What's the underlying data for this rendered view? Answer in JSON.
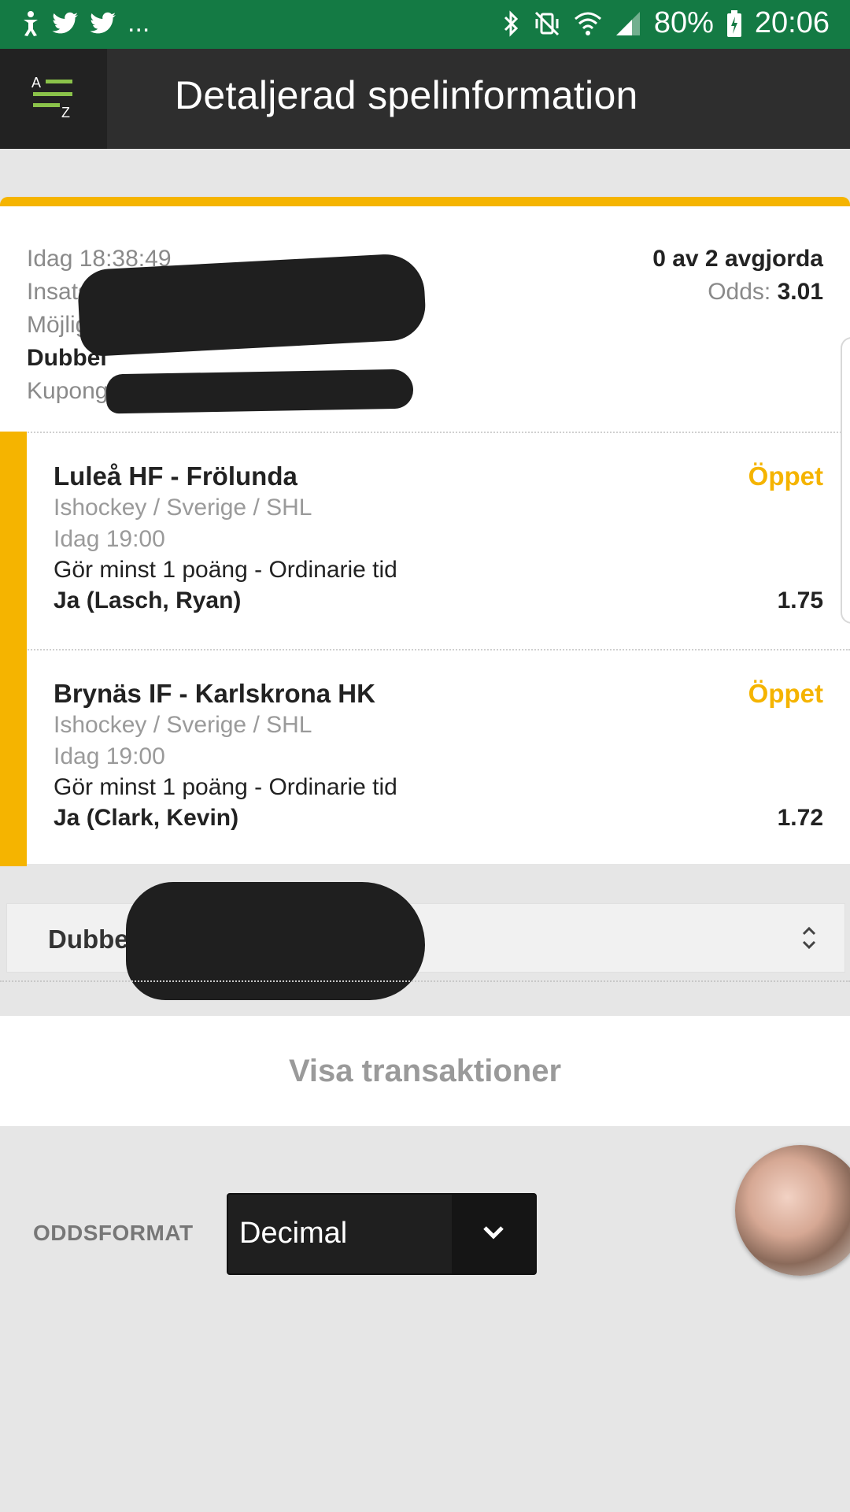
{
  "status_bar": {
    "overflow": "...",
    "battery": "80%",
    "time": "20:06"
  },
  "app_bar": {
    "title": "Detaljerad spelinformation",
    "menu_icon": "sort-az-icon"
  },
  "bet": {
    "placed": "Idag 18:38:49",
    "settled": "0 av 2 avgjorda",
    "stake_label": "Insats",
    "odds_label": "Odds:",
    "odds_value": "3.01",
    "payout_label": "Möjlig utbetalning:",
    "type": "Dubbel",
    "coupon_label": "Kupong"
  },
  "selections": [
    {
      "match": "Luleå HF - Frölunda",
      "status": "Öppet",
      "league": "Ishockey / Sverige / SHL",
      "time": "Idag 19:00",
      "market": "Gör minst 1 poäng - Ordinarie tid",
      "pick": "Ja (Lasch, Ryan)",
      "odds": "1.75"
    },
    {
      "match": "Brynäs IF - Karlskrona HK",
      "status": "Öppet",
      "league": "Ishockey / Sverige / SHL",
      "time": "Idag 19:00",
      "market": "Gör minst 1 poäng - Ordinarie tid",
      "pick": "Ja (Clark, Kevin)",
      "odds": "1.72"
    }
  ],
  "bet_type_select": {
    "label": "Dubbe"
  },
  "transactions": {
    "label": "Visa transaktioner"
  },
  "odds_format": {
    "label": "ODDSFORMAT",
    "selected": "Decimal"
  },
  "colors": {
    "status_bar": "#147a44",
    "app_bar": "#2e2e2e",
    "accent": "#f5b400"
  }
}
